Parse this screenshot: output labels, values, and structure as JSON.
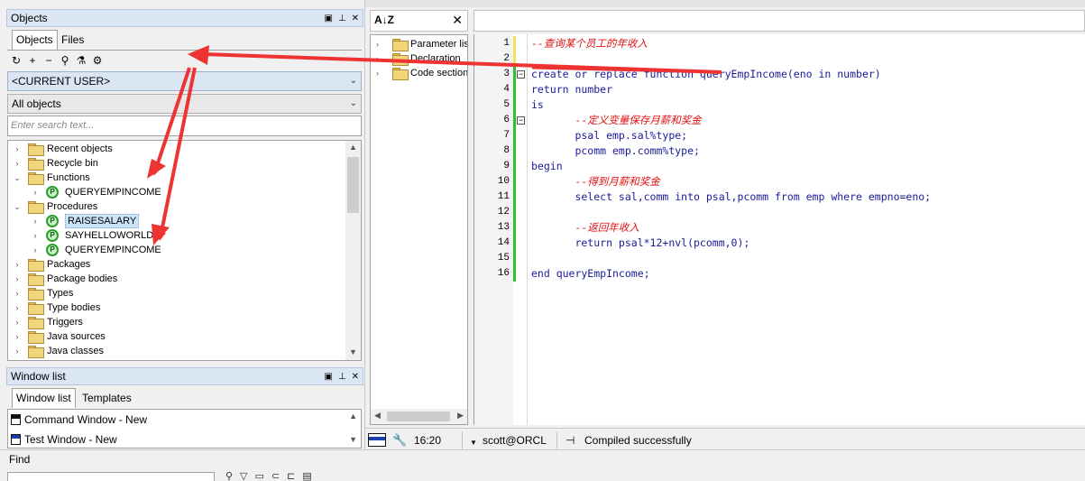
{
  "objects_panel": {
    "title": "Objects",
    "tabs": [
      "Objects",
      "Files"
    ],
    "user_combo": "<CURRENT USER>",
    "filter_combo": "All objects",
    "search_placeholder": "Enter search text..."
  },
  "tree": {
    "items": [
      {
        "label": "Recent objects",
        "kind": "folder",
        "level": 0,
        "expanded": false
      },
      {
        "label": "Recycle bin",
        "kind": "folder",
        "level": 0,
        "expanded": false
      },
      {
        "label": "Functions",
        "kind": "folder",
        "level": 0,
        "expanded": true
      },
      {
        "label": "QUERYEMPINCOME",
        "kind": "proc",
        "level": 1,
        "expanded": false
      },
      {
        "label": "Procedures",
        "kind": "folder",
        "level": 0,
        "expanded": true
      },
      {
        "label": "RAISESALARY",
        "kind": "proc",
        "level": 1,
        "expanded": false,
        "selected": true
      },
      {
        "label": "SAYHELLOWORLD",
        "kind": "proc",
        "level": 1,
        "expanded": false
      },
      {
        "label": "QUERYEMPINCOME",
        "kind": "proc",
        "level": 1,
        "expanded": false
      },
      {
        "label": "Packages",
        "kind": "folder",
        "level": 0,
        "expanded": false
      },
      {
        "label": "Package bodies",
        "kind": "folder",
        "level": 0,
        "expanded": false
      },
      {
        "label": "Types",
        "kind": "folder",
        "level": 0,
        "expanded": false
      },
      {
        "label": "Type bodies",
        "kind": "folder",
        "level": 0,
        "expanded": false
      },
      {
        "label": "Triggers",
        "kind": "folder",
        "level": 0,
        "expanded": false
      },
      {
        "label": "Java sources",
        "kind": "folder",
        "level": 0,
        "expanded": false
      },
      {
        "label": "Java classes",
        "kind": "folder",
        "level": 0,
        "expanded": false
      }
    ]
  },
  "window_list_panel": {
    "title": "Window list",
    "tabs": [
      "Window list",
      "Templates"
    ],
    "items": [
      {
        "label": "Command Window - New",
        "icon": "command-window-icon"
      },
      {
        "label": "Test Window - New",
        "icon": "test-window-icon"
      }
    ]
  },
  "find_bar": {
    "label": "Find"
  },
  "structure": {
    "items": [
      "Parameter list",
      "Declaration",
      "Code section"
    ]
  },
  "editor": {
    "lines": [
      {
        "n": "1",
        "text": "--查询某个员工的年收入",
        "comment": true
      },
      {
        "n": "2",
        "text": "",
        "comment": false
      },
      {
        "n": "3",
        "text": "create or replace function queryEmpIncome(eno in number)",
        "comment": false,
        "fold": "−"
      },
      {
        "n": "4",
        "text": "return number",
        "comment": false
      },
      {
        "n": "5",
        "text": "is",
        "comment": false
      },
      {
        "n": "6",
        "text": "       --定义变量保存月薪和奖金",
        "comment": true,
        "fold": "−"
      },
      {
        "n": "7",
        "text": "       psal emp.sal%type;",
        "comment": false
      },
      {
        "n": "8",
        "text": "       pcomm emp.comm%type;",
        "comment": false
      },
      {
        "n": "9",
        "text": "begin",
        "comment": false
      },
      {
        "n": "10",
        "text": "       --得到月薪和奖金",
        "comment": true
      },
      {
        "n": "11",
        "text": "       select sal,comm into psal,pcomm from emp where empno=eno;",
        "comment": false
      },
      {
        "n": "12",
        "text": "",
        "comment": false
      },
      {
        "n": "13",
        "text": "       --返回年收入",
        "comment": true
      },
      {
        "n": "14",
        "text": "       return psal*12+nvl(pcomm,0);",
        "comment": false
      },
      {
        "n": "15",
        "text": "",
        "comment": false
      },
      {
        "n": "16",
        "text": "end queryEmpIncome;",
        "comment": false
      }
    ]
  },
  "status": {
    "position": "16:20",
    "connection": "scott@ORCL",
    "message": "Compiled successfully"
  },
  "colors": {
    "comment": "#e01010",
    "keyword": "#1a1a9a",
    "arrow": "#ee3333",
    "panel_title": "#dbe6f4"
  }
}
